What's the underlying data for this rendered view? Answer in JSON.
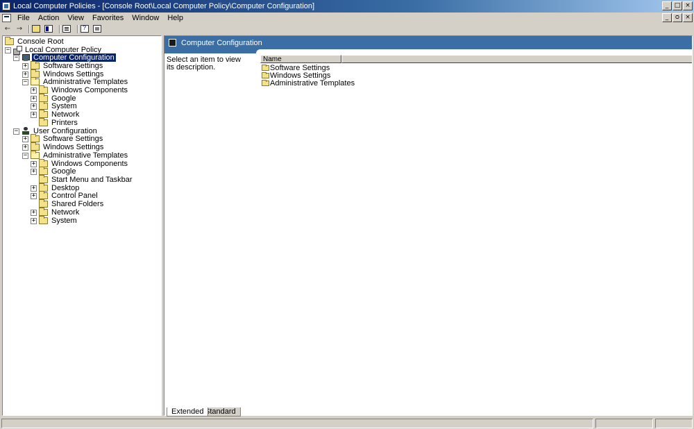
{
  "window": {
    "title": "Local Computer Policies - [Console Root\\Local Computer Policy\\Computer Configuration]",
    "caption_minimize": "_",
    "caption_maximize": "□",
    "caption_close": "×"
  },
  "menu": {
    "items": [
      "File",
      "Action",
      "View",
      "Favorites",
      "Window",
      "Help"
    ],
    "mdi_minimize": "_",
    "mdi_restore": "ᴑ",
    "mdi_close": "×"
  },
  "toolbar": {
    "back_glyph": "←",
    "forward_glyph": "→"
  },
  "tree": {
    "items": [
      {
        "label": "Console Root",
        "icon": "folder-icon",
        "expander": ""
      },
      {
        "label": "Local Computer Policy",
        "icon": "policy-icon",
        "expander": "−"
      },
      {
        "label": "Computer Configuration",
        "icon": "computer-icon",
        "expander": "−",
        "selected": true
      },
      {
        "label": "Software Settings",
        "icon": "folder-icon",
        "expander": "+"
      },
      {
        "label": "Windows Settings",
        "icon": "folder-icon",
        "expander": "+"
      },
      {
        "label": "Administrative Templates",
        "icon": "folder-icon",
        "expander": "−"
      },
      {
        "label": "Windows Components",
        "icon": "folder-icon",
        "expander": "+"
      },
      {
        "label": "Google",
        "icon": "folder-icon",
        "expander": "+"
      },
      {
        "label": "System",
        "icon": "folder-icon",
        "expander": "+"
      },
      {
        "label": "Network",
        "icon": "folder-icon",
        "expander": "+"
      },
      {
        "label": "Printers",
        "icon": "folder-icon",
        "expander": ""
      },
      {
        "label": "User Configuration",
        "icon": "user-icon",
        "expander": "−"
      },
      {
        "label": "Software Settings",
        "icon": "folder-icon",
        "expander": "+"
      },
      {
        "label": "Windows Settings",
        "icon": "folder-icon",
        "expander": "+"
      },
      {
        "label": "Administrative Templates",
        "icon": "folder-icon",
        "expander": "−"
      },
      {
        "label": "Windows Components",
        "icon": "folder-icon",
        "expander": "+"
      },
      {
        "label": "Google",
        "icon": "folder-icon",
        "expander": "+"
      },
      {
        "label": "Start Menu and Taskbar",
        "icon": "folder-icon",
        "expander": ""
      },
      {
        "label": "Desktop",
        "icon": "folder-icon",
        "expander": "+"
      },
      {
        "label": "Control Panel",
        "icon": "folder-icon",
        "expander": "+"
      },
      {
        "label": "Shared Folders",
        "icon": "folder-icon",
        "expander": ""
      },
      {
        "label": "Network",
        "icon": "folder-icon",
        "expander": "+"
      },
      {
        "label": "System",
        "icon": "folder-icon",
        "expander": "+"
      }
    ]
  },
  "right_pane": {
    "header_title": "Computer Configuration",
    "description": "Select an item to view its description.",
    "columns": [
      "Name"
    ],
    "items": [
      "Software Settings",
      "Windows Settings",
      "Administrative Templates"
    ]
  },
  "view_tabs": [
    "Extended",
    "Standard"
  ],
  "colors": {
    "header_band": "#3a6ea5",
    "selection": "#0a246a",
    "chrome": "#d4d0c8"
  }
}
